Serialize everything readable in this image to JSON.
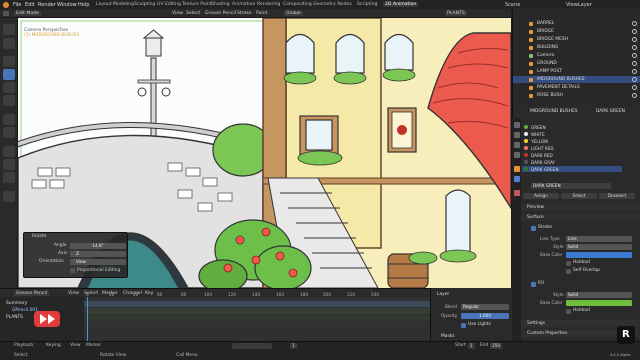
{
  "menubar": {
    "items": [
      "File",
      "Edit",
      "Render",
      "Window",
      "Help"
    ],
    "workspaces": [
      "Layout",
      "Modeling",
      "Sculpting",
      "UV Editing",
      "Texture Paint",
      "Shading",
      "Animation",
      "Rendering",
      "Compositing",
      "Geometry Nodes",
      "Scripting",
      "2D Animation"
    ],
    "active_workspace": "2D Animation",
    "scene": "Scene",
    "view_layer": "ViewLayer"
  },
  "viewport_header": {
    "mode": "Edit Mode",
    "menus": [
      "View",
      "Select",
      "Grease Pencil",
      "Stroke",
      "Point"
    ],
    "orientation": "Global",
    "layer": "PLANTS"
  },
  "viewport_overlay": {
    "line1": "Camera Perspective",
    "line2": "(1) MIDGROUND BUSHES"
  },
  "rotate_panel": {
    "title": "Rotate",
    "angle_label": "Angle",
    "angle_value": "14.8°",
    "axis_label": "Axis",
    "axis_value": "Z",
    "orientation_label": "Orientation",
    "orientation_value": "View",
    "proportional_label": "Proportional Editing"
  },
  "outliner": {
    "items": [
      {
        "label": "BARREL",
        "selected": false
      },
      {
        "label": "BRIDGE",
        "selected": false
      },
      {
        "label": "BRIDGE MESH",
        "selected": false
      },
      {
        "label": "BUILDING",
        "selected": false
      },
      {
        "label": "Camera",
        "selected": false
      },
      {
        "label": "GROUND",
        "selected": false
      },
      {
        "label": "LAMP POST",
        "selected": false
      },
      {
        "label": "MIDGROUND BUSHES",
        "selected": true
      },
      {
        "label": "PAVEMENT DETAILS",
        "selected": false
      },
      {
        "label": "ROSE BUSH",
        "selected": false
      }
    ]
  },
  "properties": {
    "object_name": "MIDGROUND BUSHES",
    "material_name": "DARK GREEN",
    "materials": [
      {
        "label": "GREEN",
        "color": "#5fae3e"
      },
      {
        "label": "WHITE",
        "color": "#f0f0f0"
      },
      {
        "label": "YELLOW",
        "color": "#f2d53c"
      },
      {
        "label": "LIGHT RED",
        "color": "#f07a6a"
      },
      {
        "label": "DARK RED",
        "color": "#c0322a"
      },
      {
        "label": "DARK GRAY",
        "color": "#555555"
      },
      {
        "label": "DARK GREEN",
        "color": "#2f7a2a"
      }
    ],
    "selected_material": "DARK GREEN",
    "buttons": [
      "Assign",
      "Select",
      "Deselect"
    ],
    "preview_label": "Preview",
    "surface_label": "Surface",
    "stroke_label": "Stroke",
    "line_type_label": "Line Type",
    "line_type_value": "Line",
    "style_label": "Style",
    "style_value": "Solid",
    "base_color_label": "Base Color",
    "stroke_color": "#3b7bd4",
    "holdout_label": "Holdout",
    "self_overlap_label": "Self Overlap",
    "fill_label": "Fill",
    "fill_style_value": "Solid",
    "fill_color": "#6fbf3b",
    "settings_label": "Settings",
    "custom_props_label": "Custom Properties"
  },
  "dopesheet": {
    "mode": "Grease Pencil",
    "menus": [
      "View",
      "Select",
      "Marker",
      "Channel",
      "Key"
    ],
    "ticks": [
      "0",
      "20",
      "40",
      "60",
      "80",
      "100",
      "120",
      "140",
      "160",
      "180",
      "200",
      "220",
      "240"
    ],
    "channels": [
      {
        "label": "Summary"
      },
      {
        "label": "GPencil.001"
      },
      {
        "label": "PLANTS"
      }
    ]
  },
  "layer_panel": {
    "title": "Layer",
    "blend_label": "Blend",
    "blend_value": "Regular",
    "opacity_label": "Opacity",
    "opacity_value": "1.000",
    "use_lights_label": "Use Lights",
    "masks_label": "Masks"
  },
  "timeline": {
    "menus": [
      "Playback",
      "Keying",
      "View",
      "Marker"
    ],
    "frame": "1",
    "start_label": "Start",
    "start_value": "1",
    "end_label": "End",
    "end_value": "250"
  },
  "statusbar": {
    "select": "Select",
    "rotate": "Rotate View",
    "call_menu": "Call Menu",
    "version": "3.4.0 Alpha"
  }
}
